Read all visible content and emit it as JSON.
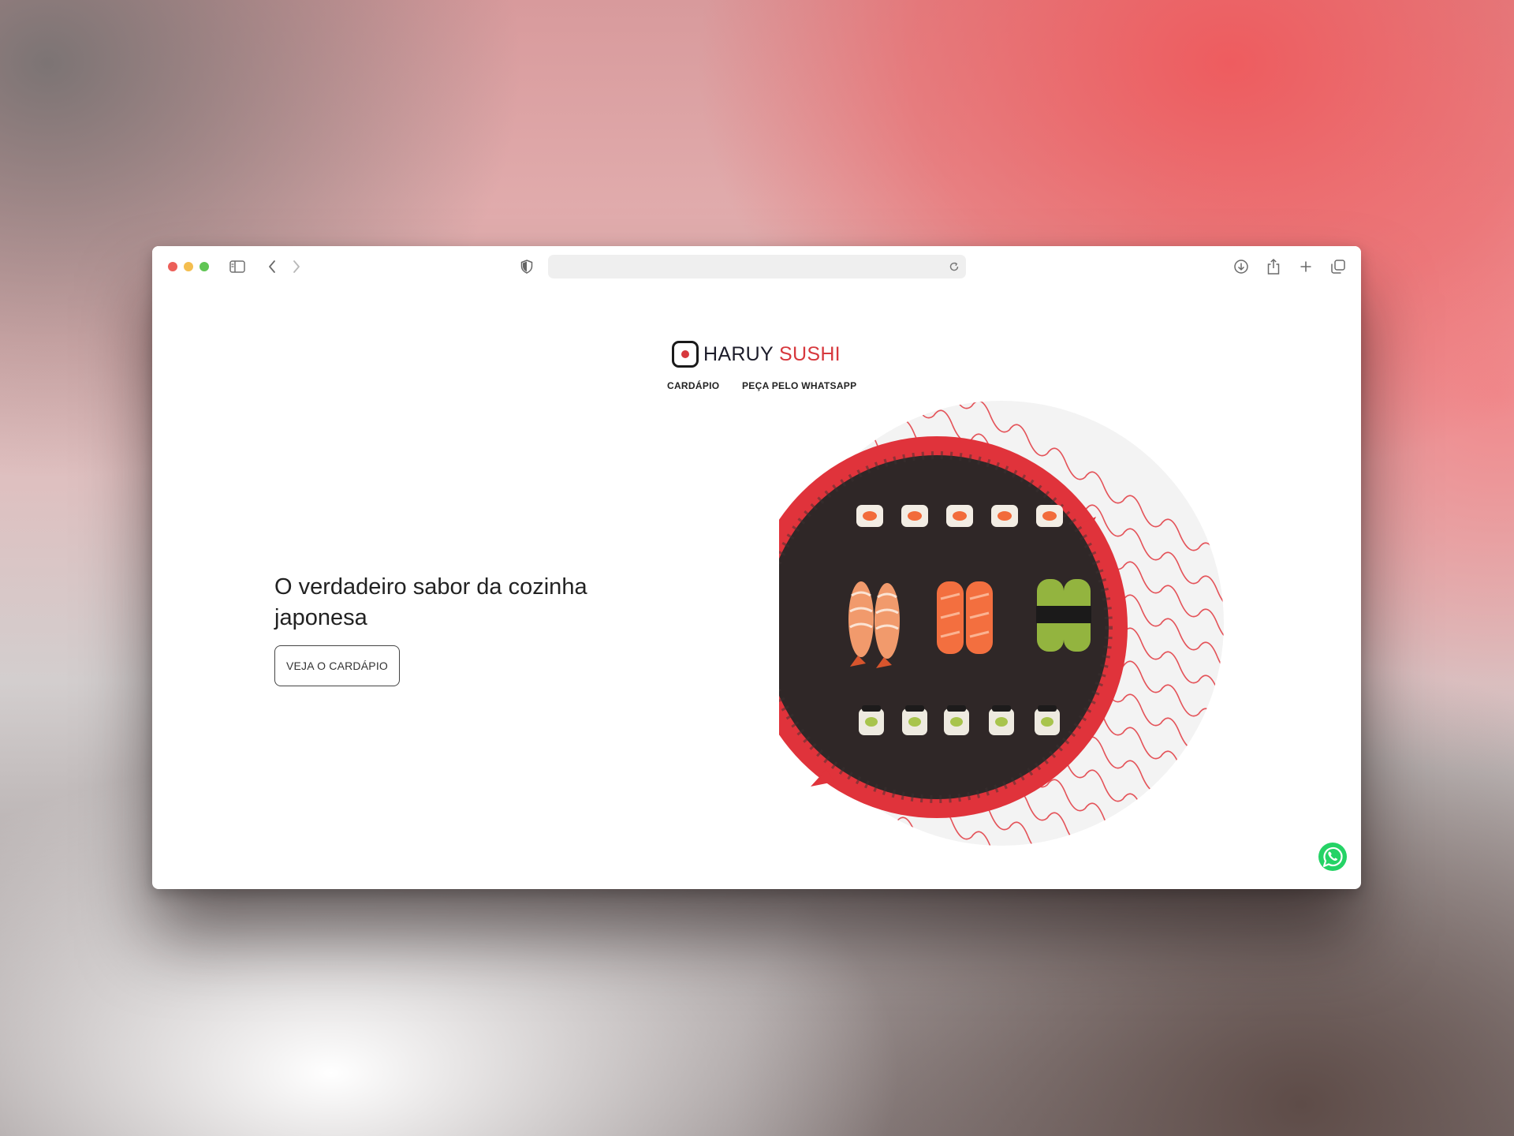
{
  "browser": {
    "toolbar_icons": [
      "sidebar-icon",
      "back-icon",
      "forward-icon",
      "shield-icon",
      "reload-icon",
      "download-icon",
      "share-icon",
      "new-tab-icon",
      "tabs-overview-icon"
    ],
    "address_bar": {
      "value": ""
    }
  },
  "site": {
    "logo": {
      "text": "HARUY",
      "accent": "SUSHI",
      "icon": "logo-square-dot-icon"
    },
    "nav": [
      {
        "label": "CARDÁPIO"
      },
      {
        "label": "PEÇA PELO WHATSAPP"
      }
    ],
    "hero": {
      "title": "O verdadeiro sabor da cozinha japonesa",
      "button_label": "VEJA O CARDÁPIO"
    },
    "floating_button": {
      "icon": "whatsapp-icon"
    },
    "colors": {
      "accent": "#d7383d",
      "text": "#1c1c2a",
      "plate": "#2f2727",
      "whatsapp": "#25d366"
    }
  }
}
